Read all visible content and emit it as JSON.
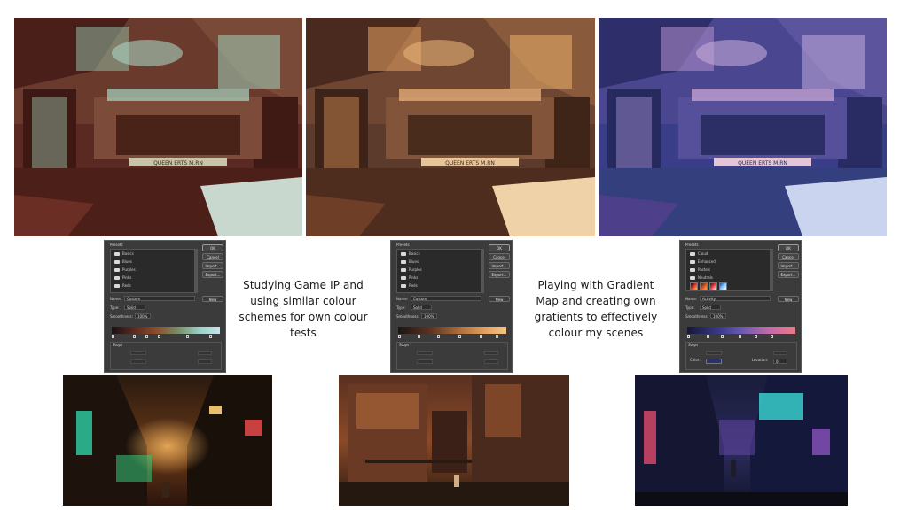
{
  "captions": {
    "left": "Studying Game IP and using similar colour schemes for own colour tests",
    "right": "Playing with Gradient Map and creating own gratients to effectively colour my scenes"
  },
  "artworks": {
    "sign_text": "QUEEN  ERTS  M.RN"
  },
  "dialogs": [
    {
      "presets_label": "Presets",
      "presets": [
        "Basics",
        "Blues",
        "Purples",
        "Pinks",
        "Reds"
      ],
      "ok": "OK",
      "cancel": "Cancel",
      "import": "Import...",
      "export": "Export...",
      "name_label": "Name:",
      "name_value": "Custom",
      "new": "New",
      "type_label": "Type:",
      "type_value": "Solid",
      "smooth_label": "Smoothness:",
      "smooth_value": "100%",
      "stops_label": "Stops"
    },
    {
      "presets_label": "Presets",
      "presets": [
        "Basics",
        "Blues",
        "Purples",
        "Pinks",
        "Reds"
      ],
      "ok": "OK",
      "cancel": "Cancel",
      "import": "Import...",
      "export": "Export...",
      "name_label": "Name:",
      "name_value": "Custom",
      "new": "New",
      "type_label": "Type:",
      "type_value": "Solid",
      "smooth_label": "Smoothness:",
      "smooth_value": "100%",
      "stops_label": "Stops"
    },
    {
      "presets_label": "Presets",
      "presets": [
        "Cloud",
        "Enhanced",
        "Pastels",
        "Neutrals"
      ],
      "ok": "OK",
      "cancel": "Cancel",
      "import": "Import...",
      "export": "Export...",
      "name_label": "Name:",
      "name_value": "Activity",
      "new": "New",
      "type_label": "Type:",
      "type_value": "Solid",
      "smooth_label": "Smoothness:",
      "smooth_value": "100%",
      "stops_label": "Stops",
      "color_label": "Color:",
      "location_label": "Location:",
      "location_value": "0"
    }
  ],
  "colors": {
    "grad1": [
      "#1a0f14",
      "#5a2f22",
      "#8a4a2a",
      "#7a8f6a",
      "#9fd1c8",
      "#c8e2ea"
    ],
    "grad2": [
      "#1c1412",
      "#5a3524",
      "#a86a3a",
      "#e0a060",
      "#f3c58a"
    ],
    "grad3": [
      "#141834",
      "#3a3a8a",
      "#6a5ab0",
      "#c06aa8",
      "#e87a8a"
    ]
  }
}
